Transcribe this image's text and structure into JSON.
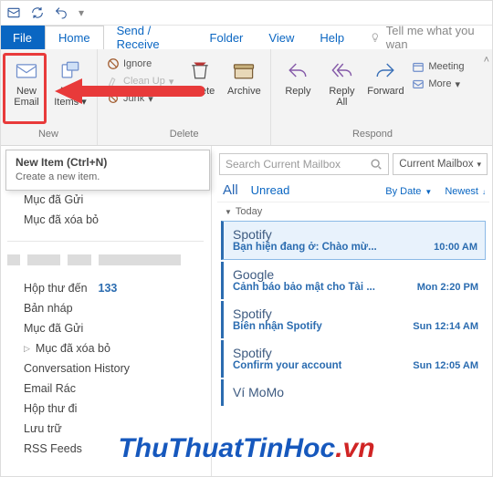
{
  "tabs": {
    "file": "File",
    "home": "Home",
    "sendreceive": "Send / Receive",
    "folder": "Folder",
    "view": "View",
    "help": "Help",
    "tellme": "Tell me what you wan"
  },
  "ribbon": {
    "new": {
      "label": "New",
      "new_email": "New\nEmail",
      "new_items": "New\nItems"
    },
    "delete": {
      "label": "Delete",
      "ignore": "Ignore",
      "cleanup": "Clean Up",
      "junk": "Junk",
      "delete": "Delete",
      "archive": "Archive"
    },
    "respond": {
      "label": "Respond",
      "reply": "Reply",
      "replyall": "Reply\nAll",
      "forward": "Forward",
      "meeting": "Meeting",
      "more": "More"
    }
  },
  "tooltip": {
    "title": "New Item (Ctrl+N)",
    "desc": "Create a new item."
  },
  "nav": {
    "sent1": "Mục đã Gửi",
    "deleted1": "Mục đã xóa bỏ",
    "inbox": "Hộp thư đến",
    "inbox_count": "133",
    "drafts": "Bản nháp",
    "sent2": "Mục đã Gửi",
    "deleted2": "Mục đã xóa bỏ",
    "conv_history": "Conversation History",
    "junk": "Email Rác",
    "outbox": "Hộp thư đi",
    "archive": "Lưu trữ",
    "rss": "RSS Feeds"
  },
  "search": {
    "placeholder": "Search Current Mailbox",
    "scope": "Current Mailbox"
  },
  "filters": {
    "all": "All",
    "unread": "Unread",
    "sort": "By Date",
    "order": "Newest"
  },
  "list": {
    "group_today": "Today",
    "items": [
      {
        "from": "Spotify",
        "subj": "Bạn hiện đang ở: Chào mừ...",
        "time": "10:00 AM",
        "selected": true
      },
      {
        "from": "Google",
        "subj": "Cảnh báo bảo mật cho Tài ...",
        "time": "Mon 2:20 PM",
        "selected": false
      },
      {
        "from": "Spotify",
        "subj": "Biên nhận Spotify",
        "time": "Sun 12:14 AM",
        "selected": false
      },
      {
        "from": "Spotify",
        "subj": "Confirm your account",
        "time": "Sun 12:05 AM",
        "selected": false
      },
      {
        "from": "Ví MoMo",
        "subj": "",
        "time": "",
        "selected": false
      }
    ]
  },
  "watermark": {
    "a": "ThuThuatTinHoc",
    "b": ".vn"
  }
}
